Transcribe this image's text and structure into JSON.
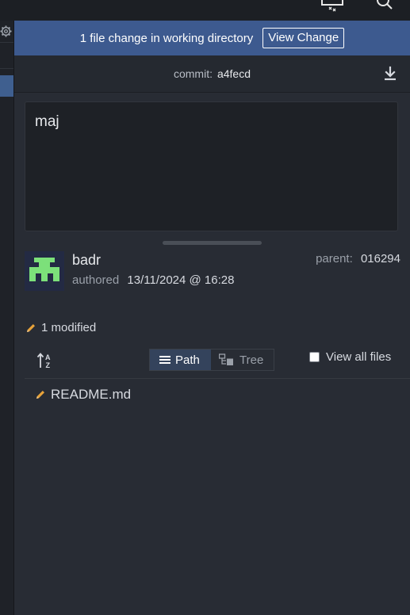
{
  "banner": {
    "message": "1 file change in working directory",
    "button_label": "View Change"
  },
  "commit": {
    "label": "commit:",
    "sha": "a4fecd"
  },
  "message": {
    "text": "maj"
  },
  "author": {
    "name": "badr",
    "authored_label": "authored",
    "date": "13/11/2024 @ 16:28",
    "parent_label": "parent:",
    "parent_sha": "016294"
  },
  "changes": {
    "modified_summary": "1 modified"
  },
  "view_toggle": {
    "path_label": "Path",
    "tree_label": "Tree",
    "selected": "Path"
  },
  "view_all_files": {
    "label": "View all files",
    "checked": false
  },
  "files": [
    {
      "name": "README.md",
      "status": "modified"
    }
  ],
  "colors": {
    "banner_bg": "#3d5a8f",
    "modified_icon": "#e8a33a",
    "avatar_fg": "#7ce07a"
  },
  "icons": {
    "download": "download-icon",
    "sort": "sort-alpha-icon",
    "path": "list-icon",
    "tree": "tree-icon",
    "modified": "pencil-icon",
    "search": "search-icon",
    "settings": "gear-icon"
  }
}
